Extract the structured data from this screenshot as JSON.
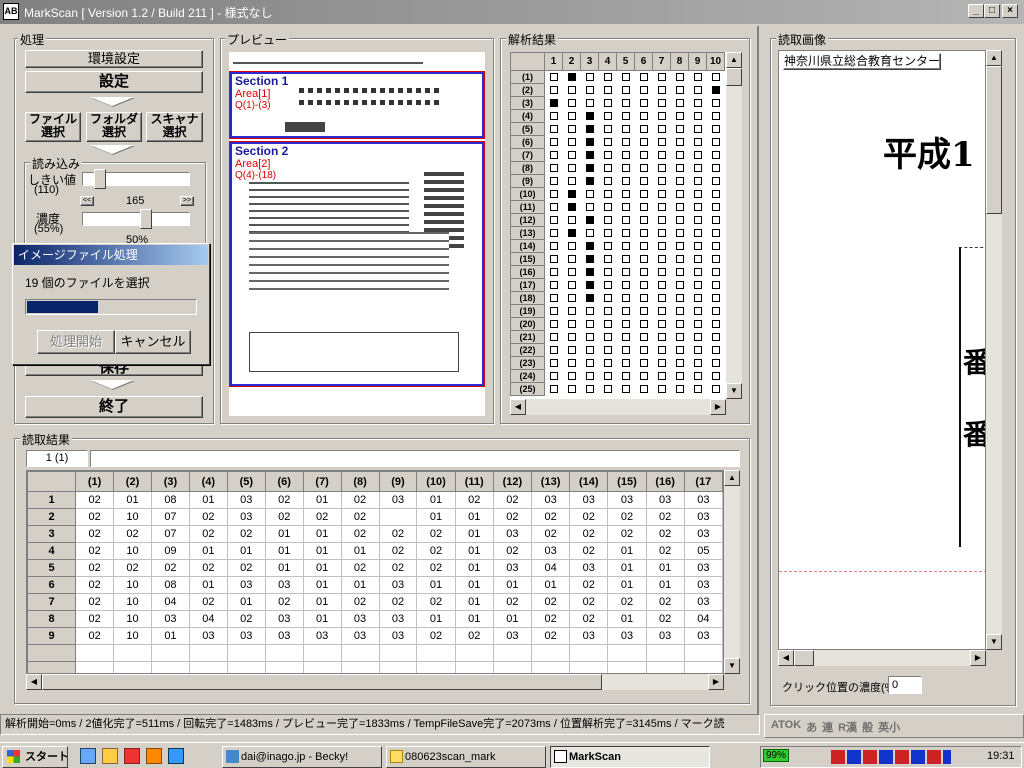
{
  "window": {
    "title": "MarkScan [ Version 1.2 / Build 211 ] - 様式なし",
    "app_icon": "AB"
  },
  "process": {
    "label": "処理",
    "env_settings": "環境設定",
    "settings": "設定",
    "file_select": "ファイル\n選択",
    "folder_select": "フォルダ\n選択",
    "scanner_select": "スキャナ\n選択",
    "read_label": "読み込み",
    "threshold_label": "しきい値",
    "threshold_paren": "(110)",
    "threshold_value": "165",
    "density_label": "濃度",
    "density_paren": "(55%)",
    "density_value": "50%",
    "save": "保存",
    "finish": "終了"
  },
  "dialog": {
    "title": "イメージファイル処理",
    "message": "19 個のファイルを選択",
    "progress": 0.42,
    "start": "処理開始",
    "cancel": "キャンセル"
  },
  "preview": {
    "label": "プレビュー",
    "section1": "Section 1",
    "area1": "Area[1]",
    "q1": "Q(1)-(3)",
    "section2": "Section 2",
    "area2": "Area[2]",
    "q2": "Q(4)-(18)"
  },
  "analysis": {
    "label": "解析結果",
    "cols": [
      "1",
      "2",
      "3",
      "4",
      "5",
      "6",
      "7",
      "8",
      "9",
      "10"
    ],
    "rows": [
      {
        "label": "(1)",
        "on": [
          2
        ]
      },
      {
        "label": "(2)",
        "on": [
          10
        ]
      },
      {
        "label": "(3)",
        "on": [
          1
        ]
      },
      {
        "label": "(4)",
        "on": [
          3
        ]
      },
      {
        "label": "(5)",
        "on": [
          3
        ]
      },
      {
        "label": "(6)",
        "on": [
          3
        ]
      },
      {
        "label": "(7)",
        "on": [
          3
        ]
      },
      {
        "label": "(8)",
        "on": [
          3
        ]
      },
      {
        "label": "(9)",
        "on": [
          3
        ]
      },
      {
        "label": "(10)",
        "on": [
          2
        ]
      },
      {
        "label": "(11)",
        "on": [
          2
        ]
      },
      {
        "label": "(12)",
        "on": [
          3
        ]
      },
      {
        "label": "(13)",
        "on": [
          2
        ]
      },
      {
        "label": "(14)",
        "on": [
          3
        ]
      },
      {
        "label": "(15)",
        "on": [
          3
        ]
      },
      {
        "label": "(16)",
        "on": [
          3
        ]
      },
      {
        "label": "(17)",
        "on": [
          3
        ]
      },
      {
        "label": "(18)",
        "on": [
          3
        ]
      },
      {
        "label": "(19)",
        "on": []
      },
      {
        "label": "(20)",
        "on": []
      },
      {
        "label": "(21)",
        "on": []
      },
      {
        "label": "(22)",
        "on": []
      },
      {
        "label": "(23)",
        "on": []
      },
      {
        "label": "(24)",
        "on": []
      },
      {
        "label": "(25)",
        "on": []
      }
    ]
  },
  "results": {
    "label": "読取結果",
    "cell_ref": "1 (1)",
    "cols": [
      "(1)",
      "(2)",
      "(3)",
      "(4)",
      "(5)",
      "(6)",
      "(7)",
      "(8)",
      "(9)",
      "(10)",
      "(11)",
      "(12)",
      "(13)",
      "(14)",
      "(15)",
      "(16)",
      "(17"
    ],
    "rows": [
      {
        "n": "1",
        "v": [
          "02",
          "01",
          "08",
          "01",
          "03",
          "02",
          "01",
          "02",
          "03",
          "01",
          "02",
          "02",
          "03",
          "03",
          "03",
          "03",
          "03"
        ]
      },
      {
        "n": "2",
        "v": [
          "02",
          "10",
          "07",
          "02",
          "03",
          "02",
          "02",
          "02",
          "",
          "01",
          "01",
          "02",
          "02",
          "02",
          "02",
          "02",
          "03"
        ]
      },
      {
        "n": "3",
        "v": [
          "02",
          "02",
          "07",
          "02",
          "02",
          "01",
          "01",
          "02",
          "02",
          "02",
          "01",
          "03",
          "02",
          "02",
          "02",
          "02",
          "03"
        ]
      },
      {
        "n": "4",
        "v": [
          "02",
          "10",
          "09",
          "01",
          "01",
          "01",
          "01",
          "01",
          "02",
          "02",
          "01",
          "02",
          "03",
          "02",
          "01",
          "02",
          "05"
        ]
      },
      {
        "n": "5",
        "v": [
          "02",
          "02",
          "02",
          "02",
          "02",
          "01",
          "01",
          "02",
          "02",
          "02",
          "01",
          "03",
          "04",
          "03",
          "01",
          "01",
          "03"
        ]
      },
      {
        "n": "6",
        "v": [
          "02",
          "10",
          "08",
          "01",
          "03",
          "03",
          "01",
          "01",
          "03",
          "01",
          "01",
          "01",
          "01",
          "02",
          "01",
          "01",
          "03"
        ]
      },
      {
        "n": "7",
        "v": [
          "02",
          "10",
          "04",
          "02",
          "01",
          "02",
          "01",
          "02",
          "02",
          "02",
          "01",
          "02",
          "02",
          "02",
          "02",
          "02",
          "03"
        ]
      },
      {
        "n": "8",
        "v": [
          "02",
          "10",
          "03",
          "04",
          "02",
          "03",
          "01",
          "03",
          "03",
          "01",
          "01",
          "01",
          "02",
          "02",
          "01",
          "02",
          "04"
        ]
      },
      {
        "n": "9",
        "v": [
          "02",
          "10",
          "01",
          "03",
          "03",
          "03",
          "03",
          "03",
          "03",
          "02",
          "02",
          "03",
          "02",
          "03",
          "03",
          "03",
          "03"
        ]
      }
    ]
  },
  "scan_image": {
    "label": "読取画像",
    "school": "神奈川県立総合教育センター",
    "big_text": "平成1",
    "mark1": "番",
    "mark2": "番",
    "click_density_label": "クリック位置の濃度(%)",
    "click_density_value": "0"
  },
  "status": {
    "text": "解析開始=0ms / 2値化完了=511ms / 回転完了=1483ms / プレビュー完了=1833ms / TempFileSave完了=2073ms / 位置解析完了=3145ms / マーク読"
  },
  "ime": {
    "items": [
      "ATOK",
      "あ",
      "連",
      "R漢",
      "般",
      "英小"
    ]
  },
  "taskbar": {
    "start": "スタート",
    "tasks": [
      "dai@inago.jp - Becky!",
      "080623scan_mark",
      "MarkScan"
    ],
    "battery": "99%",
    "clock": "19:31"
  }
}
